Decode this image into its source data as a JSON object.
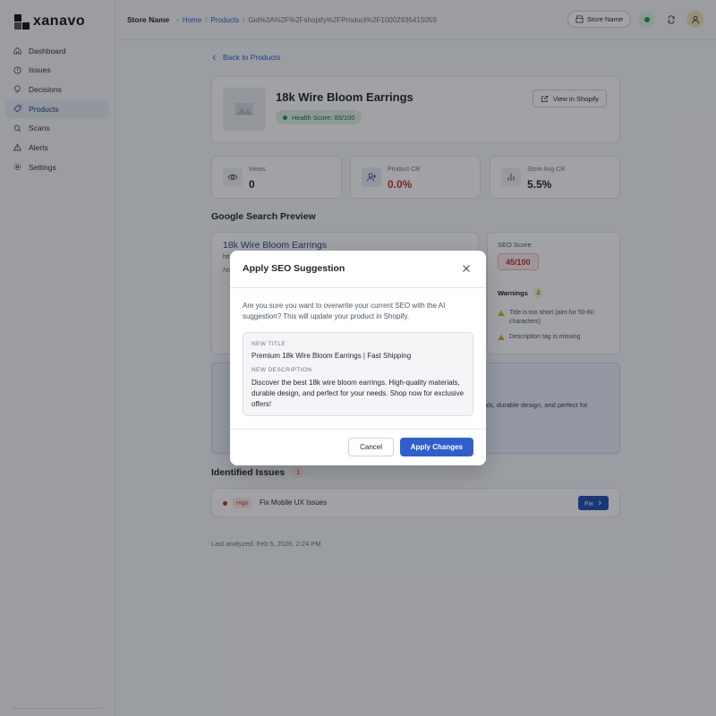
{
  "brand": {
    "name": "xanavo"
  },
  "sidebar": {
    "items": [
      {
        "label": "Dashboard",
        "icon": "home-icon"
      },
      {
        "label": "Issues",
        "icon": "alert-circle-icon"
      },
      {
        "label": "Decisions",
        "icon": "lightbulb-icon"
      },
      {
        "label": "Products",
        "icon": "tag-icon",
        "active": true
      },
      {
        "label": "Scans",
        "icon": "search-icon"
      },
      {
        "label": "Alerts",
        "icon": "warning-triangle-icon"
      },
      {
        "label": "Settings",
        "icon": "gear-icon"
      }
    ]
  },
  "header": {
    "store_title": "Store Name",
    "breadcrumb": [
      "Home",
      "Products",
      "Gid%3A%2F%2Fshopify%2FProduct%2F10002935415059"
    ],
    "store_pill": "Store Name"
  },
  "back_link": "Back to Products",
  "product": {
    "name": "18k Wire Bloom Earrings",
    "health_score": "Health Score: 85/100",
    "view_button": "View in Shopify"
  },
  "stats": [
    {
      "label": "Views",
      "value": "0",
      "icon": "eye-icon"
    },
    {
      "label": "Product CR",
      "value": "0.0%",
      "icon": "user-plus-icon",
      "alert": true
    },
    {
      "label": "Store Avg CR",
      "value": "5.5%",
      "icon": "bar-chart-icon"
    }
  ],
  "search_preview": {
    "section_title": "Google Search Preview",
    "link_text": "18k Wire Bloom Earrings",
    "url_fragment": "htt",
    "desc_fragment": "No"
  },
  "seo": {
    "score_label": "SEO Score",
    "score_value": "45/100",
    "warnings_label": "Warnings",
    "warnings_count": "2",
    "warnings": [
      "Title is too short (aim for 50-60 characters)",
      "Description tag is missing"
    ]
  },
  "ai_card": {
    "desc_fragment": "rials, durable design, and perfect for"
  },
  "issues": {
    "title": "Identified Issues",
    "count": "1",
    "items": [
      {
        "severity": "High",
        "text": "Fix Mobile UX Issues",
        "action": "Fix"
      }
    ]
  },
  "last_analyzed": "Last analyzed: Feb 5, 2026, 2:24 PM",
  "modal": {
    "title": "Apply SEO Suggestion",
    "message": "Are you sure you want to overwrite your current SEO with the AI suggestion? This will update your product in Shopify.",
    "new_title_label": "New Title",
    "new_title": "Premium 18k Wire Bloom Earrings | Fast Shipping",
    "new_desc_label": "New Description",
    "new_desc": "Discover the best 18k wire bloom earrings. High-quality materials, durable design, and perfect for your needs. Shop now for exclusive offers!",
    "cancel_label": "Cancel",
    "apply_label": "Apply Changes"
  },
  "colors": {
    "accent": "#2f5fcf",
    "danger": "#c4302b",
    "success": "#1f9d4a"
  }
}
